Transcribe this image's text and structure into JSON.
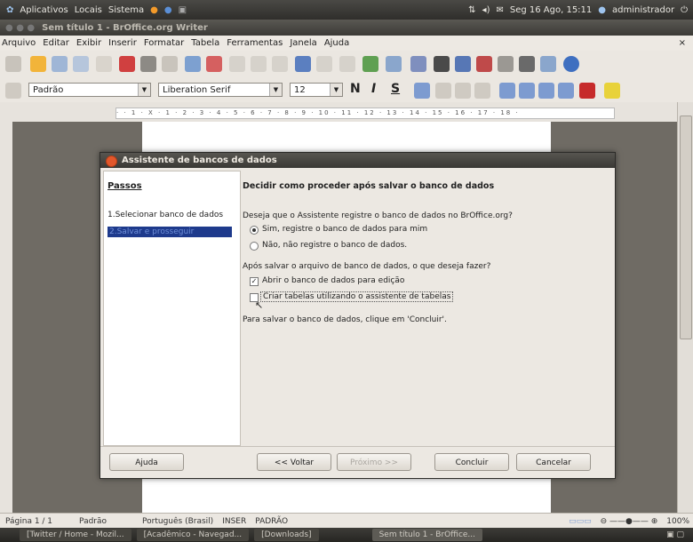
{
  "top_panel": {
    "menus": [
      "Aplicativos",
      "Locais",
      "Sistema"
    ],
    "clock": "Seg 16 Ago, 15:11",
    "user": "administrador"
  },
  "window": {
    "title": "Sem título 1 - BrOffice.org Writer"
  },
  "menu_bar": [
    "Arquivo",
    "Editar",
    "Exibir",
    "Inserir",
    "Formatar",
    "Tabela",
    "Ferramentas",
    "Janela",
    "Ajuda"
  ],
  "format_toolbar": {
    "style": "Padrão",
    "font": "Liberation Serif",
    "size": "12",
    "bold": "N",
    "italic": "I",
    "underline": "S"
  },
  "ruler": {
    "marks": "· · 1 · X · 1 · 2 · 3 · 4 · 5 · 6 · 7 · 8 · 9 · 10 · 11 · 12 · 13 · 14 · 15 · 16 · 17 · 18 ·"
  },
  "dialog": {
    "title": "Assistente de bancos de dados",
    "steps_title": "Passos",
    "steps": [
      "1.Selecionar banco de dados",
      "2.Salvar e prosseguir"
    ],
    "heading": "Decidir como proceder após salvar o banco de dados",
    "question1": "Deseja que o Assistente registre o banco de dados no BrOffice.org?",
    "radio_yes": "Sim, registre o banco de dados para mim",
    "radio_no": "Não, não registre o banco de dados.",
    "question2": "Após salvar o arquivo de banco de dados, o que deseja fazer?",
    "check_open": "Abrir o banco de dados para edição",
    "check_tables": "Criar tabelas utilizando o assistente de tabelas",
    "footer_text": "Para salvar o banco de dados, clique em 'Concluir'.",
    "buttons": {
      "help": "Ajuda",
      "back": "<< Voltar",
      "next": "Próximo >>",
      "finish": "Concluir",
      "cancel": "Cancelar"
    }
  },
  "status_bar": {
    "page": "Página 1 / 1",
    "style": "Padrão",
    "language": "Português (Brasil)",
    "insert": "INSER",
    "mode": "PADRÃO",
    "zoom": "100%"
  },
  "taskbar": [
    "[Twitter / Home - Mozil...",
    "[Acadêmico - Navegad...",
    "[Downloads]",
    "Sem título 1 - BrOffice..."
  ]
}
